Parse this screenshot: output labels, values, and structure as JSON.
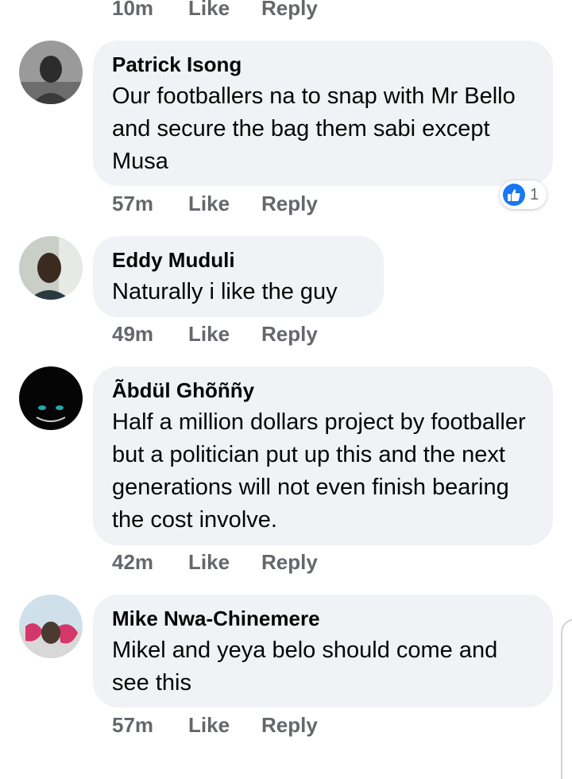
{
  "top_actions": {
    "time": "10m",
    "like": "Like",
    "reply": "Reply"
  },
  "comments": [
    {
      "name": "Patrick Isong",
      "text": "Our footballers na to snap with Mr Bello and secure the bag them sabi except Musa",
      "time": "57m",
      "like": "Like",
      "reply": "Reply",
      "reaction_count": "1"
    },
    {
      "name": "Eddy Muduli",
      "text": "Naturally i like the guy",
      "time": "49m",
      "like": "Like",
      "reply": "Reply"
    },
    {
      "name": "Ãbdül Ghõññy",
      "text": "Half a million dollars project by footballer but a politician put up this and the next generations  will not even finish bearing the cost involve.",
      "time": "42m",
      "like": "Like",
      "reply": "Reply"
    },
    {
      "name": "Mike Nwa-Chinemere",
      "text": "Mikel and yeya belo should come and see this",
      "time": "57m",
      "like": "Like",
      "reply": "Reply"
    }
  ],
  "colors": {
    "bubble": "#f0f2f5",
    "meta": "#65676b",
    "like_blue": "#1877f2"
  }
}
